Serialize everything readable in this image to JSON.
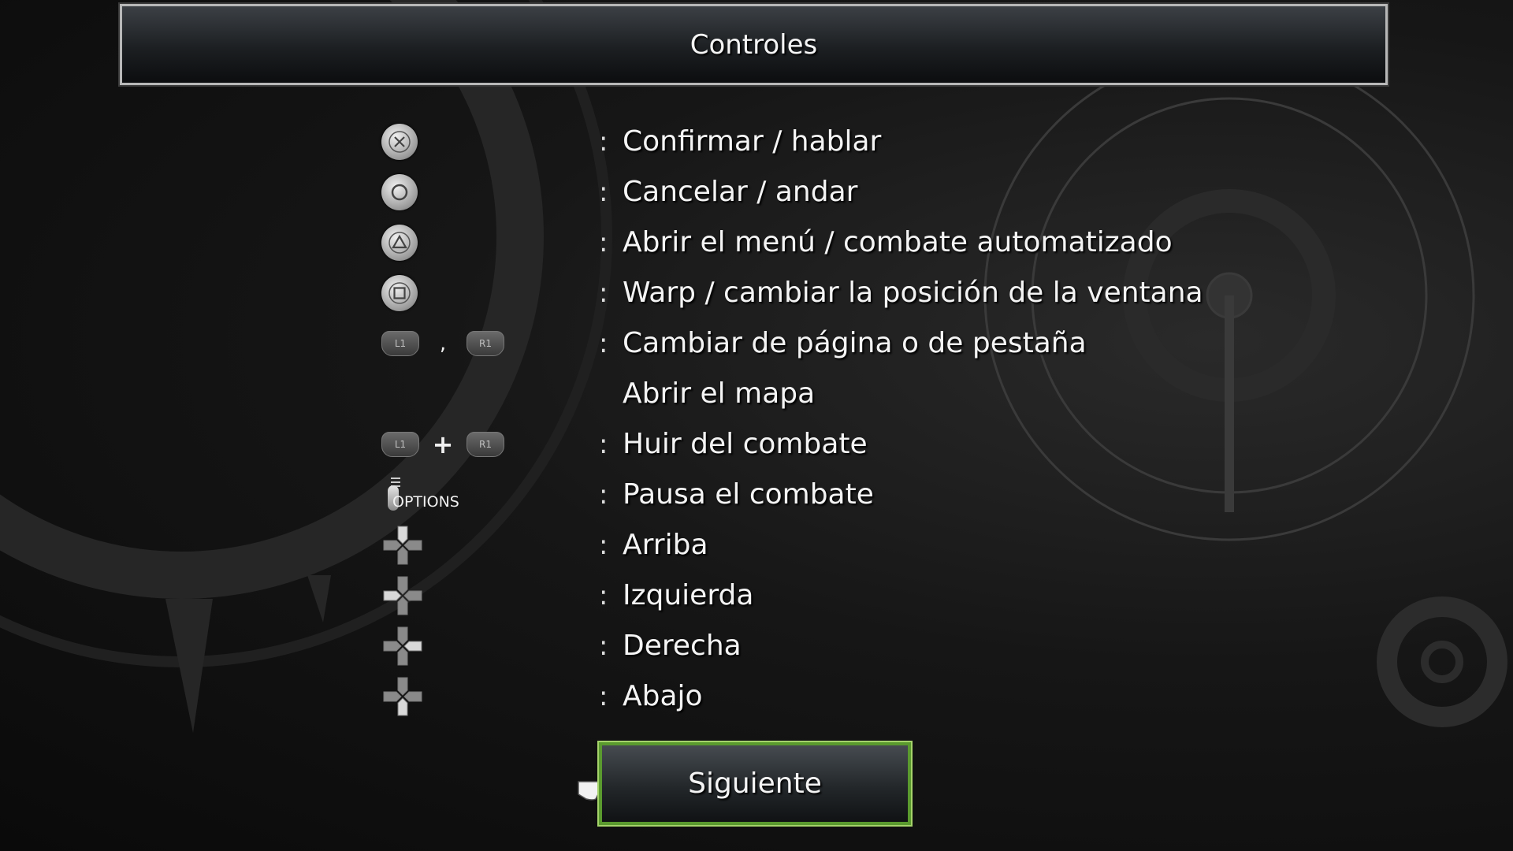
{
  "header": {
    "title": "Controles"
  },
  "controls": [
    {
      "icon": "cross-button-icon",
      "label": "Confirmar / hablar"
    },
    {
      "icon": "circle-button-icon",
      "label": "Cancelar / andar"
    },
    {
      "icon": "triangle-button-icon",
      "label": "Abrir el menú / combate automatizado"
    },
    {
      "icon": "square-button-icon",
      "label": "Warp / cambiar la posición de la ventana"
    },
    {
      "icon": "l1-r1-buttons-icon",
      "label": "Cambiar de página o de pestaña",
      "l1": "L1",
      "r1": "R1",
      "separator": ","
    },
    {
      "icon": "",
      "label": "Abrir el mapa"
    },
    {
      "icon": "l1-plus-r1-buttons-icon",
      "label": "Huir del combate",
      "l1": "L1",
      "r1": "R1",
      "separator": "+"
    },
    {
      "icon": "options-button-icon",
      "label": "Pausa el combate",
      "options": "OPTIONS"
    },
    {
      "icon": "dpad-up-icon",
      "label": "Arriba"
    },
    {
      "icon": "dpad-left-icon",
      "label": "Izquierda"
    },
    {
      "icon": "dpad-right-icon",
      "label": "Derecha"
    },
    {
      "icon": "dpad-down-icon",
      "label": "Abajo"
    }
  ],
  "colon": ":",
  "footer": {
    "next_label": "Siguiente",
    "cursor_icon": "pointing-hand-icon"
  },
  "colors": {
    "accent_green": "#5a9a2e",
    "text": "#f4f4f4"
  }
}
